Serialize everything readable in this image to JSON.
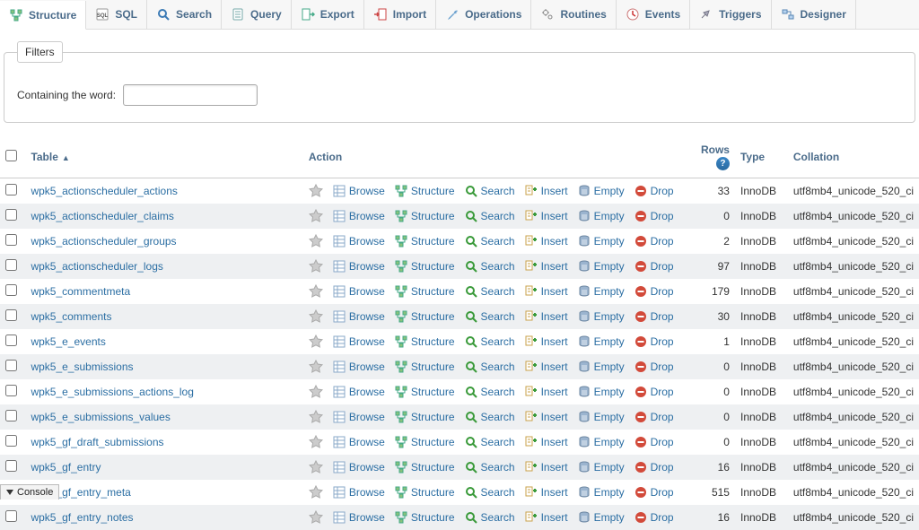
{
  "tabs": [
    {
      "label": "Structure",
      "icon": "structure"
    },
    {
      "label": "SQL",
      "icon": "sql"
    },
    {
      "label": "Search",
      "icon": "search"
    },
    {
      "label": "Query",
      "icon": "query"
    },
    {
      "label": "Export",
      "icon": "export"
    },
    {
      "label": "Import",
      "icon": "import"
    },
    {
      "label": "Operations",
      "icon": "operations"
    },
    {
      "label": "Routines",
      "icon": "routines"
    },
    {
      "label": "Events",
      "icon": "events"
    },
    {
      "label": "Triggers",
      "icon": "triggers"
    },
    {
      "label": "Designer",
      "icon": "designer"
    }
  ],
  "activeTabIndex": 0,
  "filters": {
    "legend": "Filters",
    "contain_label": "Containing the word:",
    "contain_value": ""
  },
  "columns": {
    "table": "Table",
    "action": "Action",
    "rows": "Rows",
    "type": "Type",
    "collation": "Collation"
  },
  "actions": {
    "browse": "Browse",
    "structure": "Structure",
    "search": "Search",
    "insert": "Insert",
    "empty": "Empty",
    "drop": "Drop"
  },
  "rows": [
    {
      "name": "wpk5_actionscheduler_actions",
      "rows": "33",
      "type": "InnoDB",
      "coll": "utf8mb4_unicode_520_ci"
    },
    {
      "name": "wpk5_actionscheduler_claims",
      "rows": "0",
      "type": "InnoDB",
      "coll": "utf8mb4_unicode_520_ci"
    },
    {
      "name": "wpk5_actionscheduler_groups",
      "rows": "2",
      "type": "InnoDB",
      "coll": "utf8mb4_unicode_520_ci"
    },
    {
      "name": "wpk5_actionscheduler_logs",
      "rows": "97",
      "type": "InnoDB",
      "coll": "utf8mb4_unicode_520_ci"
    },
    {
      "name": "wpk5_commentmeta",
      "rows": "179",
      "type": "InnoDB",
      "coll": "utf8mb4_unicode_520_ci"
    },
    {
      "name": "wpk5_comments",
      "rows": "30",
      "type": "InnoDB",
      "coll": "utf8mb4_unicode_520_ci"
    },
    {
      "name": "wpk5_e_events",
      "rows": "1",
      "type": "InnoDB",
      "coll": "utf8mb4_unicode_520_ci"
    },
    {
      "name": "wpk5_e_submissions",
      "rows": "0",
      "type": "InnoDB",
      "coll": "utf8mb4_unicode_520_ci"
    },
    {
      "name": "wpk5_e_submissions_actions_log",
      "rows": "0",
      "type": "InnoDB",
      "coll": "utf8mb4_unicode_520_ci"
    },
    {
      "name": "wpk5_e_submissions_values",
      "rows": "0",
      "type": "InnoDB",
      "coll": "utf8mb4_unicode_520_ci"
    },
    {
      "name": "wpk5_gf_draft_submissions",
      "rows": "0",
      "type": "InnoDB",
      "coll": "utf8mb4_unicode_520_ci"
    },
    {
      "name": "wpk5_gf_entry",
      "rows": "16",
      "type": "InnoDB",
      "coll": "utf8mb4_unicode_520_ci"
    },
    {
      "name": "wpk5_gf_entry_meta",
      "rows": "515",
      "type": "InnoDB",
      "coll": "utf8mb4_unicode_520_ci"
    },
    {
      "name": "wpk5_gf_entry_notes",
      "rows": "16",
      "type": "InnoDB",
      "coll": "utf8mb4_unicode_520_ci"
    }
  ],
  "console_label": "Console"
}
